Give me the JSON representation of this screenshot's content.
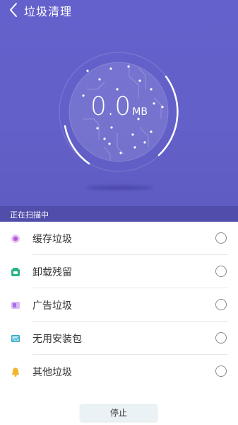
{
  "header": {
    "title": "垃圾清理"
  },
  "scan": {
    "size_value": "0.0",
    "size_unit": "MB",
    "status": "正在扫描中"
  },
  "items": [
    {
      "label": "缓存垃圾",
      "icon": "cache-icon",
      "color": "#b65ad6"
    },
    {
      "label": "卸载残留",
      "icon": "uninstall-residue-icon",
      "color": "#2bb48c"
    },
    {
      "label": "广告垃圾",
      "icon": "ad-junk-icon",
      "color": "#a66de2"
    },
    {
      "label": "无用安装包",
      "icon": "apk-package-icon",
      "color": "#32a8c8"
    },
    {
      "label": "其他垃圾",
      "icon": "other-junk-icon",
      "color": "#f3b52d"
    }
  ],
  "actions": {
    "stop_label": "停止"
  },
  "colors": {
    "primary": "#6461cc",
    "status_bar": "#504dab",
    "button_bg": "#ebf2f6"
  }
}
